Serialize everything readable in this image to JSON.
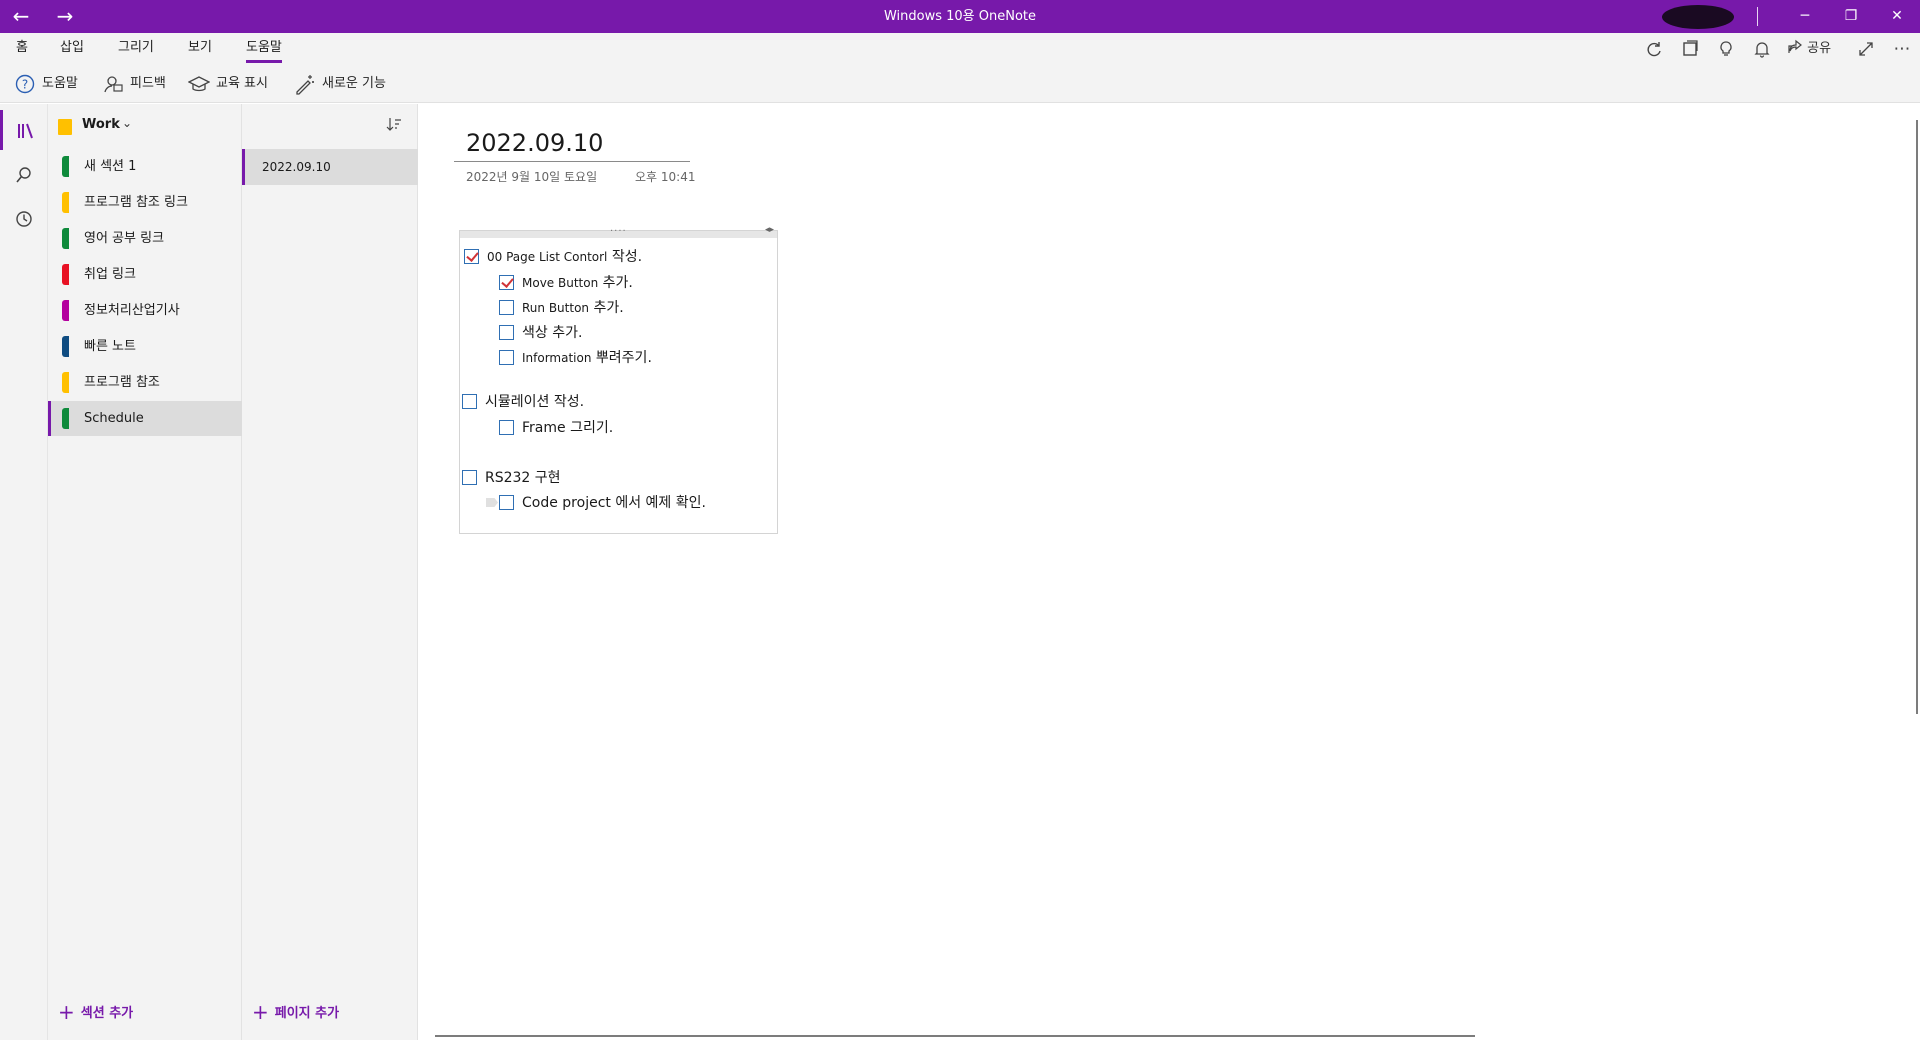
{
  "app": {
    "title": "Windows 10용 OneNote",
    "back_icon": "←",
    "forward_icon": "→",
    "window_controls": {
      "minimize": "─",
      "restore": "❐",
      "close": "✕"
    }
  },
  "menu": {
    "tabs": [
      {
        "label": "홈"
      },
      {
        "label": "삽입"
      },
      {
        "label": "그리기"
      },
      {
        "label": "보기"
      },
      {
        "label": "도움말"
      }
    ],
    "active_tab": "도움말",
    "share_label": "공유"
  },
  "ribbon": {
    "items": [
      {
        "label": "도움말",
        "icon": "help-icon"
      },
      {
        "label": "피드백",
        "icon": "feedback-icon"
      },
      {
        "label": "교육 표시",
        "icon": "training-icon"
      },
      {
        "label": "새로운 기능",
        "icon": "whats-new-icon"
      }
    ]
  },
  "notebook": {
    "name": "Work",
    "color": "#ffc000",
    "sections": [
      {
        "label": "새 섹션 1",
        "color": "#0e8a3b"
      },
      {
        "label": "프로그램 참조 링크",
        "color": "#ffc000"
      },
      {
        "label": "영어 공부 링크",
        "color": "#0e8a3b"
      },
      {
        "label": "취업 링크",
        "color": "#e81123"
      },
      {
        "label": "정보처리산업기사",
        "color": "#b4009e"
      },
      {
        "label": "빠른 노트",
        "color": "#0f4c81"
      },
      {
        "label": "프로그램 참조",
        "color": "#ffc000"
      },
      {
        "label": "Schedule",
        "color": "#0e8a3b"
      }
    ],
    "selected_section": "Schedule",
    "add_section_label": "섹션 추가"
  },
  "pages": {
    "items": [
      {
        "label": "2022.09.10"
      }
    ],
    "add_page_label": "페이지 추가"
  },
  "page": {
    "title": "2022.09.10",
    "date": "2022년 9월 10일 토요일",
    "time": "오후 10:41",
    "todos": [
      {
        "text_en": "00 Page List Contorl",
        "text_ko": " 작성.",
        "checked": true,
        "level": 0
      },
      {
        "text_en": "Move Button",
        "text_ko": " 추가.",
        "checked": true,
        "level": 1
      },
      {
        "text_en": "Run Button",
        "text_ko": " 추가.",
        "checked": false,
        "level": 1
      },
      {
        "text_en": "",
        "text_ko": "색상 추가.",
        "checked": false,
        "level": 1
      },
      {
        "text_en": "Information",
        "text_ko": " 뿌려주기.",
        "checked": false,
        "level": 1
      },
      {
        "text_en": "",
        "text_ko": "시뮬레이션 작성.",
        "checked": false,
        "level": 0
      },
      {
        "text_en": "",
        "text_ko": "Frame 그리기.",
        "checked": false,
        "level": 1
      },
      {
        "text_en": "",
        "text_ko": "RS232 구현",
        "checked": false,
        "level": 0
      },
      {
        "text_en": "",
        "text_ko": "Code project 에서 예제 확인.",
        "checked": false,
        "level": 1
      }
    ]
  },
  "colors": {
    "accent": "#7719aa",
    "checkbox_border": "#2f6fb3",
    "checkmark": "#d13438"
  }
}
